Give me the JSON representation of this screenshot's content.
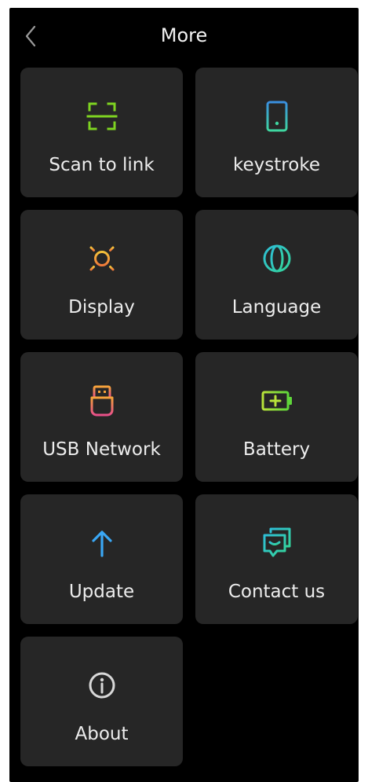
{
  "header": {
    "title": "More"
  },
  "tiles": [
    {
      "label": "Scan to link",
      "icon": "scan-icon",
      "color": "#7ed321"
    },
    {
      "label": "keystroke",
      "icon": "tablet-icon",
      "color": "#3fc7a8"
    },
    {
      "label": "Display",
      "icon": "sun-icon",
      "color": "#f5a33a"
    },
    {
      "label": "Language",
      "icon": "globe-icon",
      "color": "#2ecfc0"
    },
    {
      "label": "USB Network",
      "icon": "usb-icon",
      "color": "#f06a6a"
    },
    {
      "label": "Battery",
      "icon": "battery-icon",
      "color": "#9be23a"
    },
    {
      "label": "Update",
      "icon": "arrow-up-icon",
      "color": "#3aa7f5"
    },
    {
      "label": "Contact us",
      "icon": "chat-icon",
      "color": "#2ecfc0"
    },
    {
      "label": "About",
      "icon": "info-icon",
      "color": "#d8d8d8"
    }
  ]
}
